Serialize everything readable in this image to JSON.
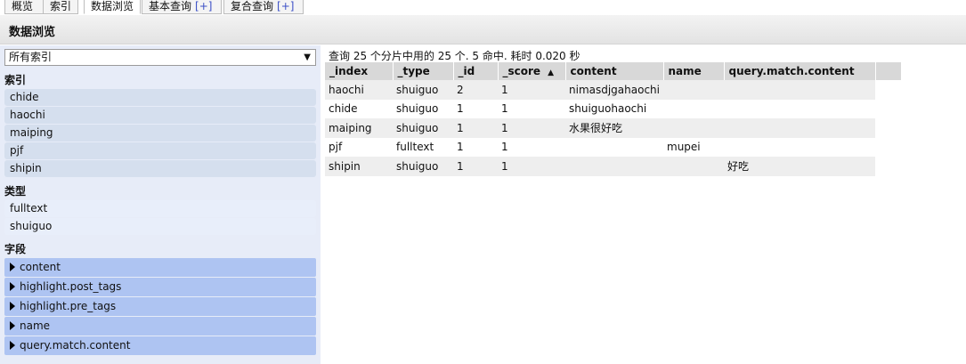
{
  "tabs": [
    {
      "label": "概览",
      "plus": ""
    },
    {
      "label": "索引",
      "plus": ""
    },
    {
      "label": "数据浏览",
      "plus": ""
    },
    {
      "label": "基本查询",
      "plus": "[+]"
    },
    {
      "label": "复合查询",
      "plus": "[+]"
    }
  ],
  "header": {
    "title": "数据浏览"
  },
  "sidebar": {
    "index_select": "所有索引",
    "index_heading": "索引",
    "indices": [
      "chide",
      "haochi",
      "maiping",
      "pjf",
      "shipin"
    ],
    "type_heading": "类型",
    "types": [
      "fulltext",
      "shuiguo"
    ],
    "field_heading": "字段",
    "fields": [
      "content",
      "highlight.post_tags",
      "highlight.pre_tags",
      "name",
      "query.match.content"
    ]
  },
  "results": {
    "summary": "查询 25 个分片中用的 25 个. 5 命中. 耗时 0.020 秒",
    "columns": [
      "_index",
      "_type",
      "_id",
      "_score",
      "content",
      "name",
      "query.match.content"
    ],
    "sort_indicator": "▲",
    "rows": [
      [
        "haochi",
        "shuiguo",
        "2",
        "1",
        "nimasdjgahaochi",
        "",
        ""
      ],
      [
        "chide",
        "shuiguo",
        "1",
        "1",
        "shuiguohaochi",
        "",
        ""
      ],
      [
        "maiping",
        "shuiguo",
        "1",
        "1",
        "水果很好吃",
        "",
        ""
      ],
      [
        "pjf",
        "fulltext",
        "1",
        "1",
        "",
        "mupei",
        ""
      ],
      [
        "shipin",
        "shuiguo",
        "1",
        "1",
        "",
        "",
        "好吃"
      ]
    ]
  }
}
